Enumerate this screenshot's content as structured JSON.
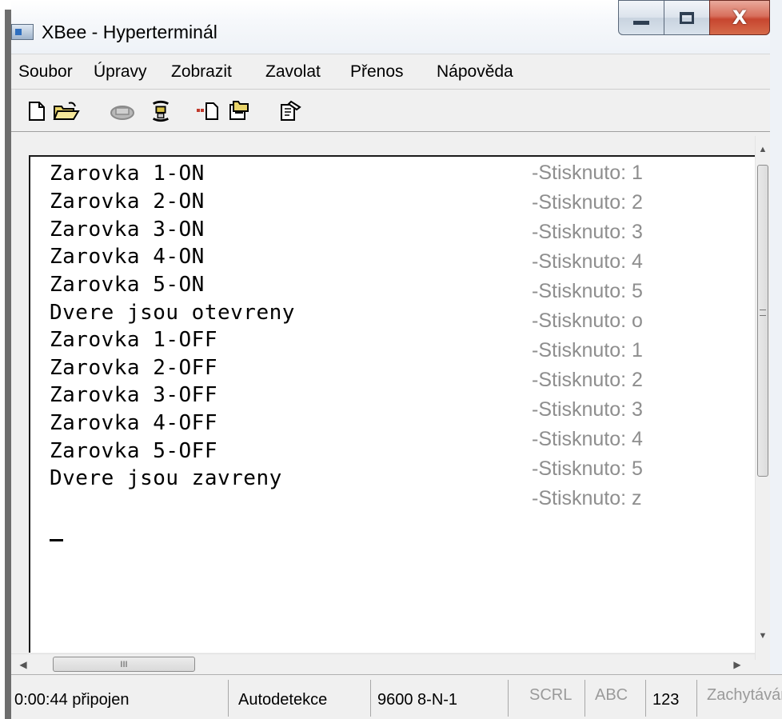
{
  "window": {
    "title": "XBee - Hyperterminál",
    "icon": "hyperterminal-app-icon",
    "buttons": {
      "minimize": "window-minimize-icon",
      "maximize": "window-maximize-icon",
      "close": "X"
    }
  },
  "menu": [
    "Soubor",
    "Úpravy",
    "Zobrazit",
    "Zavolat",
    "Přenos",
    "Nápověda"
  ],
  "toolbar": [
    "new-connection-icon",
    "open-icon",
    "disconnect-phone-icon",
    "connect-phone-icon",
    "send-icon",
    "receive-icon",
    "properties-icon"
  ],
  "terminal": {
    "lines": [
      "Zarovka 1-ON",
      "Zarovka 2-ON",
      "Zarovka 3-ON",
      "Zarovka 4-ON",
      "Zarovka 5-ON",
      "Dvere jsou otevreny",
      "Zarovka 1-OFF",
      "Zarovka 2-OFF",
      "Zarovka 3-OFF",
      "Zarovka 4-OFF",
      "Zarovka 5-OFF",
      "Dvere jsou zavreny"
    ],
    "cursor": "_"
  },
  "annotations": [
    "-Stisknuto: 1",
    "-Stisknuto: 2",
    "-Stisknuto: 3",
    "-Stisknuto: 4",
    "-Stisknuto: 5",
    "-Stisknuto: o",
    "-Stisknuto: 1",
    "-Stisknuto: 2",
    "-Stisknuto: 3",
    "-Stisknuto: 4",
    "-Stisknuto: 5",
    "-Stisknuto: z"
  ],
  "scrollbar": {
    "h_thumb_grip": "III",
    "v_thumb_grip": "≡"
  },
  "status": {
    "connected_time": "0:00:44 připojen",
    "detect": "Autodetekce",
    "port_settings": "9600 8-N-1",
    "scrl": "SCRL",
    "caps": "ABC",
    "num": "123",
    "capture": "Zachytávání"
  },
  "colors": {
    "annotation_text": "#8e8e8e",
    "close_button": "#c7462f"
  }
}
